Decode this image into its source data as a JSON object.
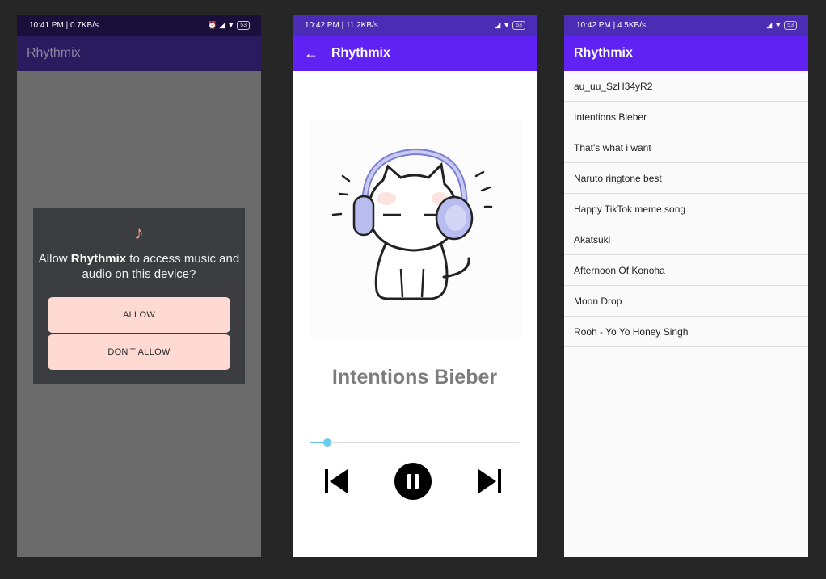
{
  "permission_screen": {
    "status": {
      "text": "10:41 PM | 0.7KB/s",
      "extra": "⏰ ◂",
      "battery": "53"
    },
    "app_title": "Rhythmix",
    "dialog": {
      "icon": "music-note-icon",
      "message_prefix": "Allow ",
      "message_app": "Rhythmix",
      "message_suffix": " to access music and audio on this device?",
      "allow_label": "ALLOW",
      "deny_label": "DON'T ALLOW"
    }
  },
  "player_screen": {
    "status": {
      "text": "10:42 PM | 11.2KB/s",
      "extra": "⏰ ●",
      "battery": "53"
    },
    "app_title": "Rhythmix",
    "song_title": "Intentions Bieber",
    "progress": 0.08,
    "controls": [
      "skip-previous-icon",
      "pause-icon",
      "skip-next-icon"
    ],
    "accent": "#6021f3"
  },
  "list_screen": {
    "status": {
      "text": "10:42 PM | 4.5KB/s",
      "extra": "⏰ ●",
      "battery": "53"
    },
    "app_title": "Rhythmix",
    "songs": [
      "au_uu_SzH34yR2",
      "Intentions Bieber",
      "That's what i want",
      "Naruto ringtone best",
      "Happy TikTok meme song",
      "Akatsuki",
      "Afternoon Of Konoha",
      "Moon Drop",
      "Rooh - Yo Yo Honey Singh"
    ]
  }
}
